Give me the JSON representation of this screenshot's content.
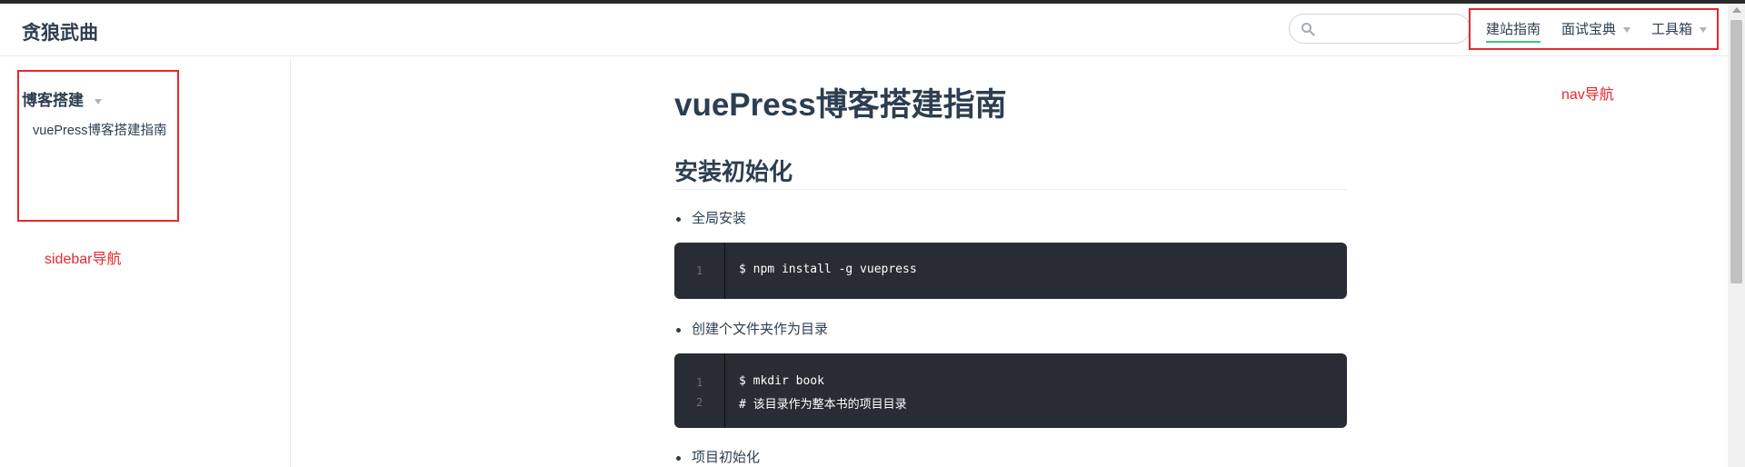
{
  "site": {
    "name": "贪狼武曲"
  },
  "search": {
    "placeholder": "",
    "value": ""
  },
  "nav": {
    "items": [
      {
        "label": "建站指南",
        "active": true,
        "dropdown": false
      },
      {
        "label": "面试宝典",
        "active": false,
        "dropdown": true
      },
      {
        "label": "工具箱",
        "active": false,
        "dropdown": true
      }
    ]
  },
  "sidebar": {
    "group_title": "博客搭建",
    "links": [
      {
        "label": "vuePress博客搭建指南"
      }
    ]
  },
  "annotations": {
    "nav_label": "nav导航",
    "sidebar_label": "sidebar导航",
    "color": "#e8272b"
  },
  "content": {
    "title": "vuePress博客搭建指南",
    "section_title": "安装初始化",
    "bullet1": "全局安装",
    "code1": {
      "line_numbers": [
        "1"
      ],
      "lines": [
        "$ npm install -g vuepress"
      ]
    },
    "bullet2": "创建个文件夹作为目录",
    "code2": {
      "line_numbers": [
        "1",
        "2"
      ],
      "lines": [
        "$ mkdir book",
        "# 该目录作为整本书的项目目录"
      ]
    },
    "bullet3": "项目初始化"
  },
  "colors": {
    "accent": "#46bd87",
    "text": "#2c3e50",
    "code_bg": "#282c34"
  }
}
